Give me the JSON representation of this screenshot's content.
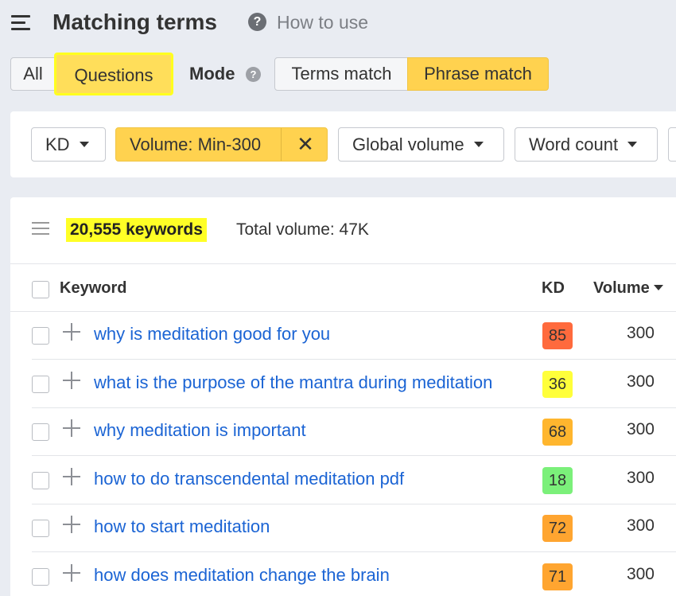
{
  "header": {
    "title": "Matching terms",
    "help_icon": "?",
    "how_to_use": "How to use"
  },
  "tabs": {
    "all": "All",
    "questions": "Questions",
    "mode_label": "Mode",
    "mode_help": "?",
    "terms_match": "Terms match",
    "phrase_match": "Phrase match",
    "active_tab": "Questions",
    "active_mode": "Phrase match"
  },
  "filters": {
    "kd": "KD",
    "volume": "Volume: Min-300",
    "volume_clear": "✕",
    "global_volume": "Global volume",
    "word_count": "Word count"
  },
  "summary": {
    "keywords_count": "20,555 keywords",
    "total_volume": "Total volume: 47K"
  },
  "table": {
    "columns": {
      "keyword": "Keyword",
      "kd": "KD",
      "volume": "Volume"
    },
    "rows": [
      {
        "keyword": "why is meditation good for you",
        "kd": "85",
        "kd_color": "#ff6a3d",
        "volume": "300"
      },
      {
        "keyword": "what is the purpose of the mantra during meditation",
        "kd": "36",
        "kd_color": "#ffff3a",
        "volume": "300"
      },
      {
        "keyword": "why meditation is important",
        "kd": "68",
        "kd_color": "#ffb62e",
        "volume": "300"
      },
      {
        "keyword": "how to do transcendental meditation pdf",
        "kd": "18",
        "kd_color": "#7bf07a",
        "volume": "300"
      },
      {
        "keyword": "how to start meditation",
        "kd": "72",
        "kd_color": "#ffa530",
        "volume": "300"
      },
      {
        "keyword": "how does meditation change the brain",
        "kd": "71",
        "kd_color": "#ffa530",
        "volume": "300"
      }
    ]
  },
  "colors": {
    "highlight_yellow": "#ffff26",
    "active_orange": "#ffd24f",
    "link_blue": "#1b64d4",
    "background": "#e9ecf2"
  }
}
